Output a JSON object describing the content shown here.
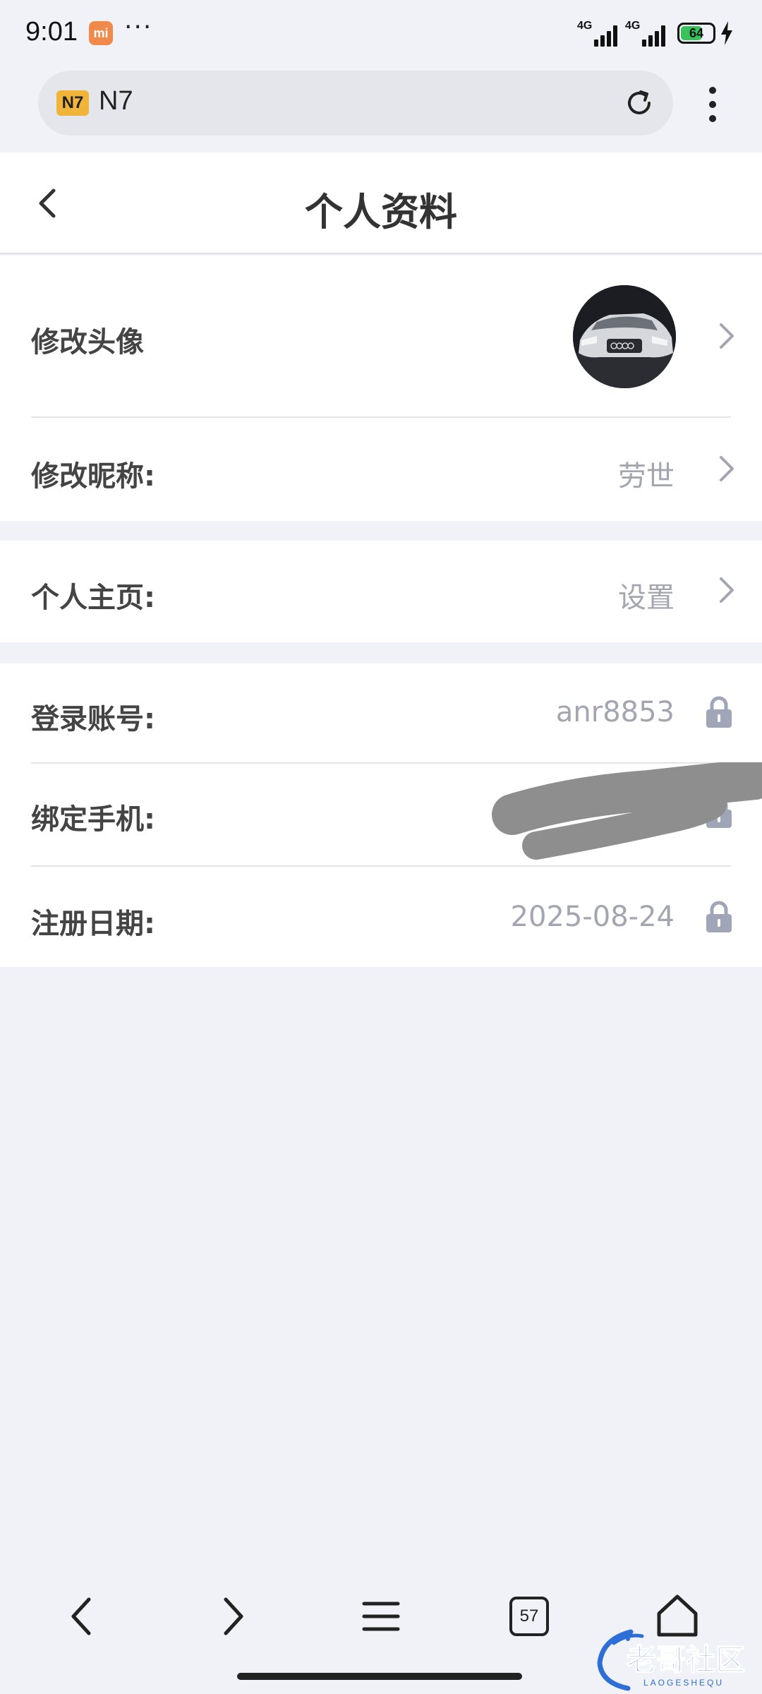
{
  "status_bar": {
    "time": "9:01",
    "app_badge": "mi",
    "more": "···",
    "signal_1": "4G",
    "signal_2": "4G",
    "battery": "64"
  },
  "browser": {
    "site_logo": "N7",
    "url_text": "N7",
    "reload_icon": "reload-icon",
    "menu_icon": "more-vertical-icon"
  },
  "header": {
    "title": "个人资料",
    "back_icon": "chevron-left-icon"
  },
  "profile": {
    "avatar_label": "修改头像",
    "nickname_label": "修改昵称:",
    "nickname_value": "劳世",
    "homepage_label": "个人主页:",
    "homepage_value": "设置",
    "account_label": "登录账号:",
    "account_value": "anr8853",
    "phone_label": "绑定手机:",
    "register_label": "注册日期:",
    "register_value": "2025-08-24"
  },
  "bottom_nav": {
    "back_icon": "back-icon",
    "forward_icon": "forward-icon",
    "menu_icon": "menu-icon",
    "tabs_count": "57",
    "home_icon": "home-icon"
  },
  "watermark": {
    "main": "老哥社区",
    "sub": "LAOGESHEQU"
  },
  "colors": {
    "page_bg": "#f1f2f7",
    "card_bg": "#ffffff",
    "label": "#444444",
    "value": "#a3a6b0",
    "lock": "#a1a5b8",
    "redaction": "#8e8e8e"
  }
}
